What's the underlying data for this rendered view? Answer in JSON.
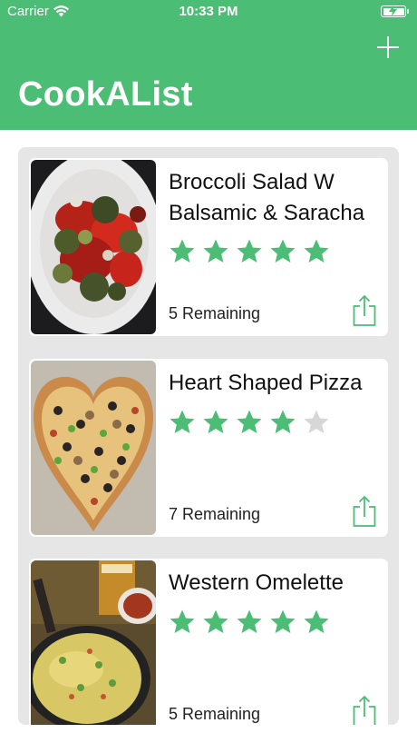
{
  "status_bar": {
    "carrier": "Carrier",
    "time": "10:33 PM"
  },
  "header": {
    "title": "CookAList",
    "add_icon": "plus-icon",
    "background_color": "#4bbd74"
  },
  "colors": {
    "accent": "#4bbd74",
    "star_filled": "#4bbd74",
    "star_empty": "#d7d7d7",
    "panel_background": "#e7e6e7"
  },
  "recipes": [
    {
      "title": "Broccoli Salad W Balsamic & Saracha",
      "rating": 5,
      "rating_max": 5,
      "remaining": "5 Remaining",
      "share_icon": "share-icon",
      "image": "broccoli-salad-photo"
    },
    {
      "title": "Heart Shaped Pizza",
      "rating": 4,
      "rating_max": 5,
      "remaining": "7 Remaining",
      "share_icon": "share-icon",
      "image": "heart-pizza-photo"
    },
    {
      "title": "Western Omelette",
      "rating": 5,
      "rating_max": 5,
      "remaining": "5 Remaining",
      "share_icon": "share-icon",
      "image": "omelette-photo"
    }
  ]
}
